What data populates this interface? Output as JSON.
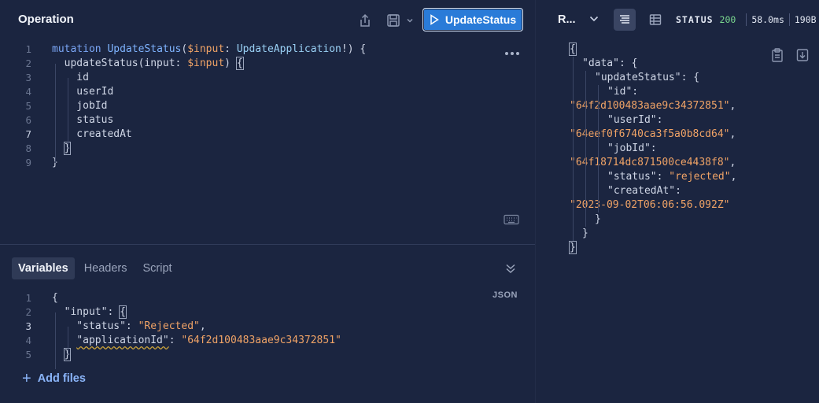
{
  "operation": {
    "title": "Operation",
    "run_label": "UpdateStatus",
    "lines": [
      {
        "n": "1",
        "parts": [
          [
            "kw",
            "mutation "
          ],
          [
            "fn",
            "UpdateStatus"
          ],
          [
            "prop",
            "("
          ],
          [
            "var",
            "$input"
          ],
          [
            "prop",
            ": "
          ],
          [
            "typ",
            "UpdateApplication"
          ],
          [
            "prop",
            "!) {"
          ]
        ]
      },
      {
        "n": "2",
        "parts": [
          [
            "prop",
            "  updateStatus(input: "
          ],
          [
            "var",
            "$input"
          ],
          [
            "prop",
            ") "
          ],
          [
            "hl",
            "{"
          ]
        ]
      },
      {
        "n": "3",
        "parts": [
          [
            "prop",
            "    id"
          ]
        ]
      },
      {
        "n": "4",
        "parts": [
          [
            "prop",
            "    userId"
          ]
        ]
      },
      {
        "n": "5",
        "parts": [
          [
            "prop",
            "    jobId"
          ]
        ]
      },
      {
        "n": "6",
        "parts": [
          [
            "prop",
            "    status"
          ]
        ]
      },
      {
        "n": "7",
        "parts": [
          [
            "prop",
            "    createdAt"
          ]
        ]
      },
      {
        "n": "8",
        "parts": [
          [
            "prop",
            "  "
          ],
          [
            "hl",
            "}"
          ]
        ]
      },
      {
        "n": "9",
        "parts": [
          [
            "prop",
            "}"
          ]
        ]
      }
    ],
    "active_line": "7"
  },
  "tabs": [
    "Variables",
    "Headers",
    "Script"
  ],
  "active_tab": "Variables",
  "json_label": "JSON",
  "variables": {
    "lines": [
      {
        "n": "1",
        "parts": [
          [
            "prop",
            "{"
          ]
        ]
      },
      {
        "n": "2",
        "parts": [
          [
            "prop",
            "  \"input\": "
          ],
          [
            "hl",
            "{"
          ]
        ]
      },
      {
        "n": "3",
        "parts": [
          [
            "prop",
            "    \"status\": "
          ],
          [
            "str",
            "\"Rejected\""
          ],
          [
            "prop",
            ","
          ]
        ]
      },
      {
        "n": "4",
        "parts": [
          [
            "prop",
            "    "
          ],
          [
            "sq",
            "\"applicationId\""
          ],
          [
            "prop",
            ": "
          ],
          [
            "str",
            "\"64f2d100483aae9c34372851\""
          ]
        ]
      },
      {
        "n": "5",
        "parts": [
          [
            "prop",
            "  "
          ],
          [
            "hl",
            "}"
          ]
        ]
      }
    ],
    "active_line": "3"
  },
  "add_files_label": "Add files",
  "response": {
    "title": "R...",
    "status_label": "STATUS",
    "status_code": "200",
    "time": "58.0ms",
    "size": "190B",
    "lines": [
      {
        "indent": 0,
        "parts": [
          [
            "hl",
            "{"
          ]
        ]
      },
      {
        "indent": 1,
        "parts": [
          [
            "prop",
            "\"data\": {"
          ]
        ]
      },
      {
        "indent": 2,
        "parts": [
          [
            "prop",
            "\"updateStatus\": {"
          ]
        ]
      },
      {
        "indent": 3,
        "parts": [
          [
            "prop",
            "\"id\":"
          ]
        ]
      },
      {
        "indent": -1,
        "parts": [
          [
            "str",
            "\"64f2d100483aae9c34372851\""
          ],
          [
            "prop",
            ","
          ]
        ]
      },
      {
        "indent": 3,
        "parts": [
          [
            "prop",
            "\"userId\":"
          ]
        ]
      },
      {
        "indent": -1,
        "parts": [
          [
            "str",
            "\"64eef0f6740ca3f5a0b8cd64\""
          ],
          [
            "prop",
            ","
          ]
        ]
      },
      {
        "indent": 3,
        "parts": [
          [
            "prop",
            "\"jobId\":"
          ]
        ]
      },
      {
        "indent": -1,
        "parts": [
          [
            "str",
            "\"64f18714dc871500ce4438f8\""
          ],
          [
            "prop",
            ","
          ]
        ]
      },
      {
        "indent": 3,
        "parts": [
          [
            "prop",
            "\"status\": "
          ],
          [
            "str",
            "\"rejected\""
          ],
          [
            "prop",
            ","
          ]
        ]
      },
      {
        "indent": 3,
        "parts": [
          [
            "prop",
            "\"createdAt\":"
          ]
        ]
      },
      {
        "indent": -1,
        "parts": [
          [
            "str",
            "\"2023-09-02T06:06:56.092Z\""
          ]
        ]
      },
      {
        "indent": 2,
        "parts": [
          [
            "prop",
            "}"
          ]
        ]
      },
      {
        "indent": 1,
        "parts": [
          [
            "prop",
            "}"
          ]
        ]
      },
      {
        "indent": 0,
        "parts": [
          [
            "hl",
            "}"
          ]
        ]
      }
    ]
  },
  "colors": {
    "accent": "#2a7bd8",
    "status_ok": "#7bd88f",
    "string": "#f0a366",
    "keyword": "#7aa6f5"
  }
}
